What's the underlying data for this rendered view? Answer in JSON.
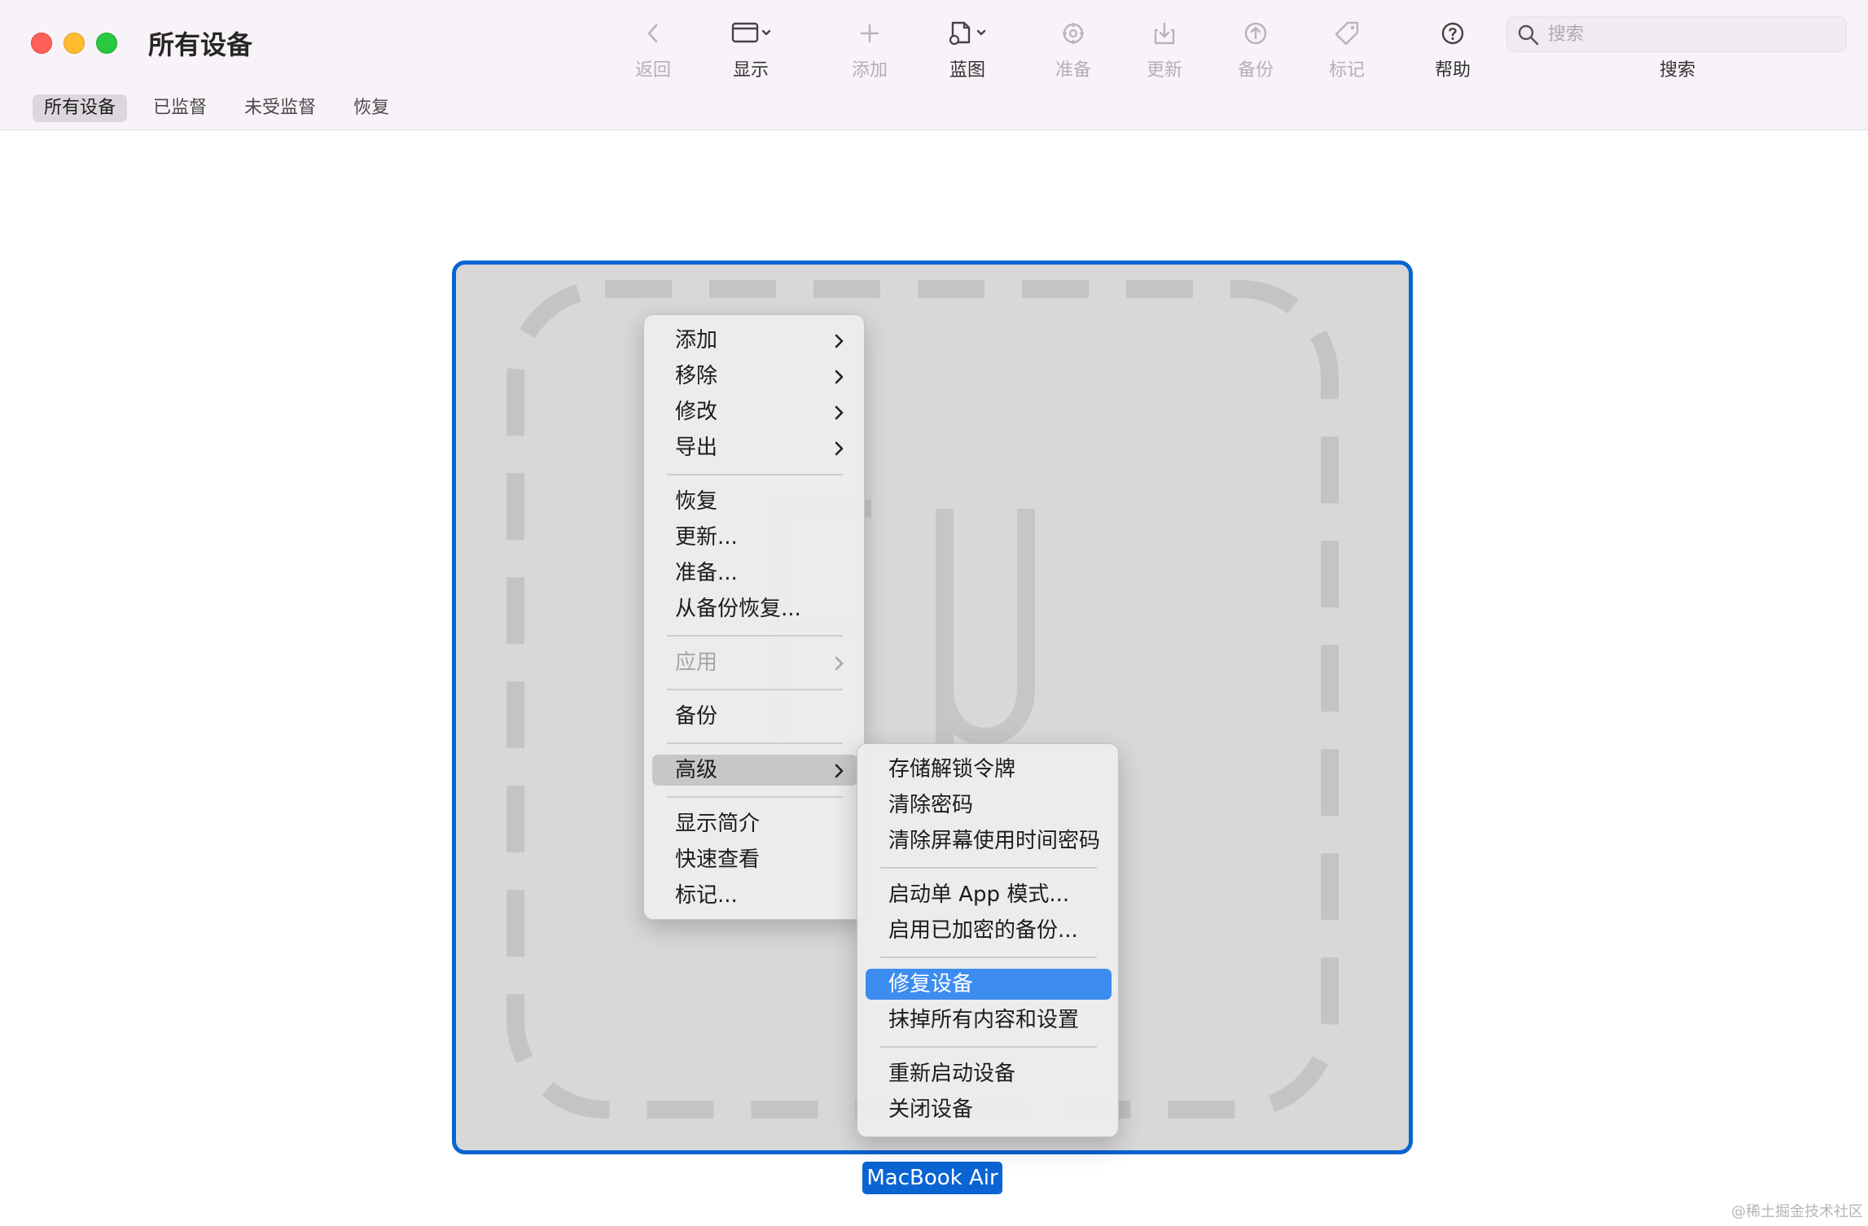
{
  "window": {
    "title": "所有设备"
  },
  "toolbar": {
    "back": "返回",
    "view": "显示",
    "add": "添加",
    "blueprint": "蓝图",
    "prepare": "准备",
    "update": "更新",
    "backup": "备份",
    "tag": "标记",
    "help": "帮助",
    "search_label": "搜索",
    "search_placeholder": "搜索"
  },
  "scope_tabs": [
    "所有设备",
    "已监督",
    "未受监督",
    "恢复"
  ],
  "device": {
    "caption": "MacBook Air"
  },
  "context_menu": {
    "items": [
      "添加",
      "移除",
      "修改",
      "导出",
      "恢复",
      "更新...",
      "准备...",
      "从备份恢复...",
      "应用",
      "备份",
      "高级",
      "显示简介",
      "快速查看",
      "标记..."
    ]
  },
  "advanced_submenu": {
    "items": [
      "存储解锁令牌",
      "清除密码",
      "清除屏幕使用时间密码",
      "启动单 App 模式...",
      "启用已加密的备份...",
      "修复设备",
      "抹掉所有内容和设置",
      "重新启动设备",
      "关闭设备"
    ]
  },
  "colors": {
    "accent": "#0a64d2",
    "menu_highlight": "#3d8cf0",
    "traffic_red": "#ff5f57",
    "traffic_yellow": "#febc2e",
    "traffic_green": "#28c840"
  },
  "watermark": "@稀土掘金技术社区"
}
